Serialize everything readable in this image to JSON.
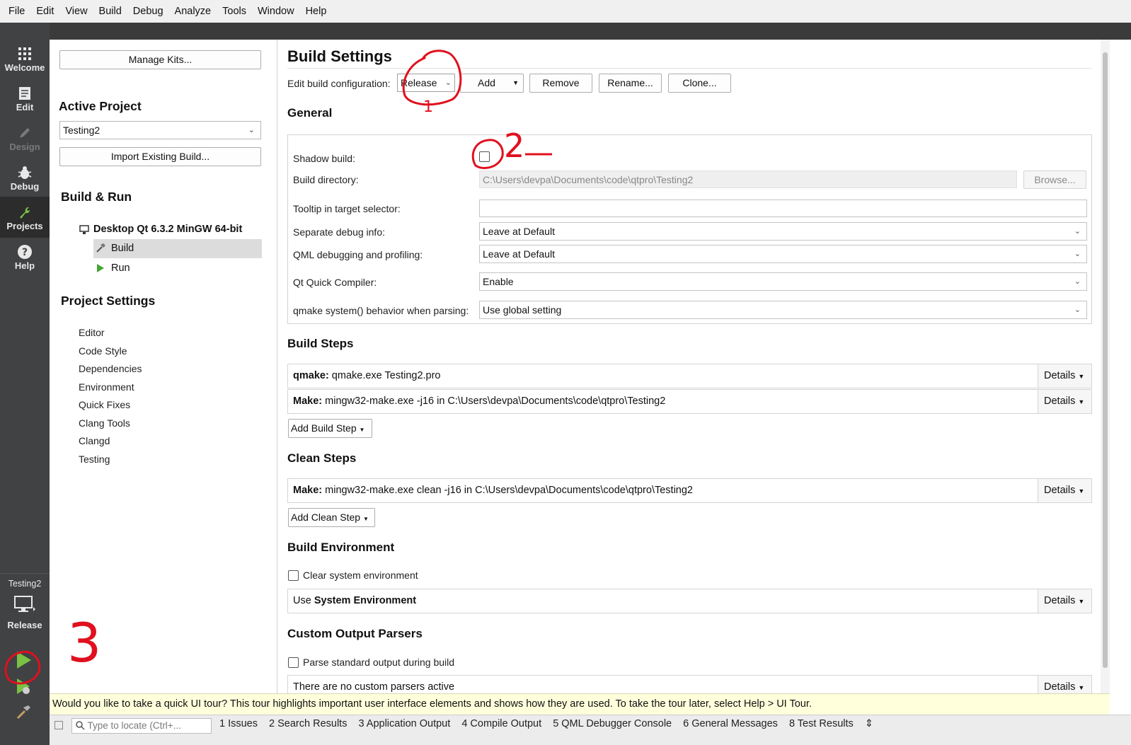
{
  "menubar": [
    "File",
    "Edit",
    "View",
    "Build",
    "Debug",
    "Analyze",
    "Tools",
    "Window",
    "Help"
  ],
  "modes": [
    {
      "label": "Welcome",
      "icon": "grid-icon"
    },
    {
      "label": "Edit",
      "icon": "document-icon"
    },
    {
      "label": "Design",
      "icon": "pencil-icon"
    },
    {
      "label": "Debug",
      "icon": "bug-icon"
    },
    {
      "label": "Projects",
      "icon": "wrench-icon"
    },
    {
      "label": "Help",
      "icon": "help-circle-icon"
    }
  ],
  "kit_selector": {
    "project": "Testing2",
    "config": "Release"
  },
  "sidebar": {
    "manage_kits": "Manage Kits...",
    "active_project_heading": "Active Project",
    "project_combo": "Testing2",
    "import_build": "Import Existing Build...",
    "build_run_heading": "Build & Run",
    "kit_name": "Desktop Qt 6.3.2 MinGW 64-bit",
    "kit_build": "Build",
    "kit_run": "Run",
    "project_settings_heading": "Project Settings",
    "settings_items": [
      "Editor",
      "Code Style",
      "Dependencies",
      "Environment",
      "Quick Fixes",
      "Clang Tools",
      "Clangd",
      "Testing"
    ]
  },
  "main": {
    "title": "Build Settings",
    "edit_config_label": "Edit build configuration:",
    "config_value": "Release",
    "add": "Add",
    "remove": "Remove",
    "rename": "Rename...",
    "clone": "Clone...",
    "general_heading": "General",
    "shadow_build_label": "Shadow build:",
    "shadow_build_checked": false,
    "build_dir_label": "Build directory:",
    "build_dir_value": "C:\\Users\\devpa\\Documents\\code\\qtpro\\Testing2",
    "browse": "Browse...",
    "tooltip_label": "Tooltip in target selector:",
    "tooltip_value": "",
    "sep_debug_label": "Separate debug info:",
    "sep_debug_value": "Leave at Default",
    "qml_debug_label": "QML debugging and profiling:",
    "qml_debug_value": "Leave at Default",
    "quick_compiler_label": "Qt Quick Compiler:",
    "quick_compiler_value": "Enable",
    "qmake_behavior_label": "qmake system() behavior when parsing:",
    "qmake_behavior_value": "Use global setting",
    "build_steps_heading": "Build Steps",
    "build_steps": [
      {
        "bold": "qmake:",
        "text": " qmake.exe Testing2.pro"
      },
      {
        "bold": "Make:",
        "text": " mingw32-make.exe -j16 in C:\\Users\\devpa\\Documents\\code\\qtpro\\Testing2"
      }
    ],
    "details": "Details",
    "add_build_step": "Add Build Step",
    "clean_steps_heading": "Clean Steps",
    "clean_step": {
      "bold": "Make:",
      "text": " mingw32-make.exe clean -j16 in C:\\Users\\devpa\\Documents\\code\\qtpro\\Testing2"
    },
    "add_clean_step": "Add Clean Step",
    "build_env_heading": "Build Environment",
    "clear_env_label": "Clear system environment",
    "use_env_prefix": "Use ",
    "use_env_bold": "System Environment",
    "custom_parsers_heading": "Custom Output Parsers",
    "parse_std_label": "Parse standard output during build",
    "no_parsers": "There are no custom parsers active"
  },
  "tour_text": "Would you like to take a quick UI tour? This tour highlights important user interface elements and shows how they are used. To take the tour later, select Help > UI Tour.",
  "statusbar": {
    "locator_placeholder": "Type to locate (Ctrl+...",
    "panes": [
      "1  Issues",
      "2  Search Results",
      "3  Application Output",
      "4  Compile Output",
      "5  QML Debugger Console",
      "6  General Messages",
      "8  Test Results"
    ]
  },
  "annotations": {
    "mark1": "1",
    "mark2": "2",
    "mark3": "3"
  },
  "colors": {
    "accent_green": "#7ac143",
    "annotation_red": "#e0101e",
    "tour_bg": "#ffffdc"
  }
}
